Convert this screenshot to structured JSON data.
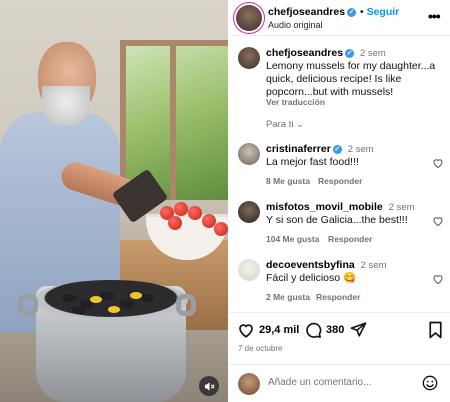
{
  "post": {
    "username": "chefjoseandres",
    "follow_label": "Seguir",
    "audio": "Audio original",
    "more_icon": "more-options-icon"
  },
  "caption": {
    "username": "chefjoseandres",
    "time": "2 sem",
    "text": "Lemony mussels for my daughter...a quick, delicious recipe! Is like popcorn...but with mussels!",
    "translate": "Ver traducción"
  },
  "sort": {
    "label": "Para ti"
  },
  "comments": [
    {
      "username": "cristinaferrer",
      "verified": true,
      "time": "2 sem",
      "text": "La mejor fast food!!!",
      "likes": "8 Me gusta",
      "reply": "Responder"
    },
    {
      "username": "misfotos_movil_mobile",
      "verified": false,
      "time": "2 sem",
      "text": "Y si son de Galicia...the best!!!",
      "likes": "104 Me gusta",
      "reply": "Responder"
    },
    {
      "username": "decoeventsbyfina",
      "verified": false,
      "time": "2 sem",
      "text": "Fácil y delicioso 😋",
      "likes": "2 Me gusta",
      "reply": "Responder"
    }
  ],
  "actions": {
    "like_count": "29,4 mil",
    "comment_count": "380"
  },
  "date": "7 de octubre",
  "add_comment": {
    "placeholder": "Añade un comentario..."
  },
  "colors": {
    "link_blue": "#0095f6",
    "verified_blue": "#3897f0",
    "muted": "#737373"
  }
}
